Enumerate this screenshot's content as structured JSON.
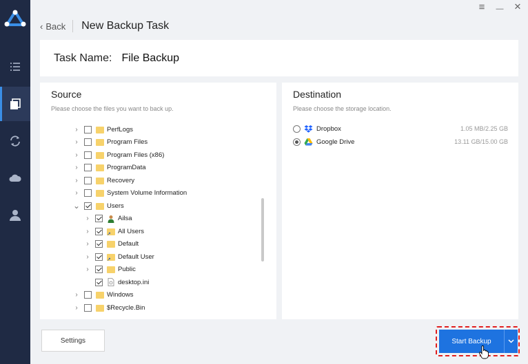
{
  "window": {
    "menu_icon": "≡",
    "minimize_icon": "—",
    "close_icon": "✕"
  },
  "sidebar": {
    "items": [
      {
        "icon": "list-icon"
      },
      {
        "icon": "backup-icon",
        "active": true
      },
      {
        "icon": "sync-icon"
      },
      {
        "icon": "cloud-icon"
      },
      {
        "icon": "user-icon"
      }
    ]
  },
  "header": {
    "back_label": "Back",
    "title": "New Backup Task"
  },
  "task": {
    "label": "Task Name:",
    "value": "File Backup"
  },
  "source": {
    "title": "Source",
    "subtitle": "Please choose the files you want to back up.",
    "items": [
      {
        "label": "PerfLogs",
        "level": 0,
        "chevron": ">",
        "checked": false,
        "icon": "folder"
      },
      {
        "label": "Program Files",
        "level": 0,
        "chevron": ">",
        "checked": false,
        "icon": "folder"
      },
      {
        "label": "Program Files (x86)",
        "level": 0,
        "chevron": ">",
        "checked": false,
        "icon": "folder"
      },
      {
        "label": "ProgramData",
        "level": 0,
        "chevron": ">",
        "checked": false,
        "icon": "folder"
      },
      {
        "label": "Recovery",
        "level": 0,
        "chevron": ">",
        "checked": false,
        "icon": "folder"
      },
      {
        "label": "System Volume Information",
        "level": 0,
        "chevron": ">",
        "checked": false,
        "icon": "folder"
      },
      {
        "label": "Users",
        "level": 0,
        "chevron": "v",
        "checked": true,
        "icon": "folder"
      },
      {
        "label": "Ailsa",
        "level": 1,
        "chevron": ">",
        "checked": true,
        "icon": "user"
      },
      {
        "label": "All Users",
        "level": 1,
        "chevron": ">",
        "checked": true,
        "icon": "folder-link"
      },
      {
        "label": "Default",
        "level": 1,
        "chevron": ">",
        "checked": true,
        "icon": "folder"
      },
      {
        "label": "Default User",
        "level": 1,
        "chevron": ">",
        "checked": true,
        "icon": "folder-link"
      },
      {
        "label": "Public",
        "level": 1,
        "chevron": ">",
        "checked": true,
        "icon": "folder"
      },
      {
        "label": "desktop.ini",
        "level": 1,
        "chevron": "",
        "checked": true,
        "icon": "file"
      },
      {
        "label": "Windows",
        "level": 0,
        "chevron": ">",
        "checked": false,
        "icon": "folder"
      },
      {
        "label": "$Recycle.Bin",
        "level": 0,
        "chevron": ">",
        "checked": false,
        "icon": "folder"
      }
    ]
  },
  "destination": {
    "title": "Destination",
    "subtitle": "Please choose the storage location.",
    "items": [
      {
        "label": "Dropbox",
        "size": "1.05 MB/2.25 GB",
        "selected": false,
        "icon": "dropbox",
        "color": "#1f62ff"
      },
      {
        "label": "Google Drive",
        "size": "13.11 GB/15.00 GB",
        "selected": true,
        "icon": "google-drive",
        "color": "#34a853"
      }
    ]
  },
  "footer": {
    "settings_label": "Settings",
    "start_label": "Start Backup",
    "dropdown_icon": "chevron-down"
  },
  "colors": {
    "sidebar": "#1f2a44",
    "accent": "#1e73e0",
    "highlight": "#e01e1e"
  }
}
